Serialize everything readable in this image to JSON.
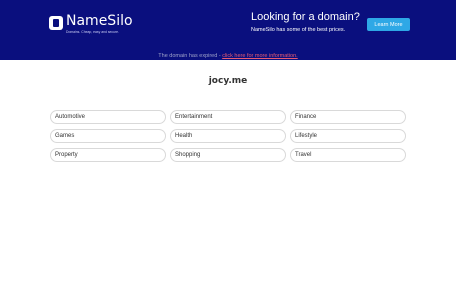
{
  "brand": {
    "name": "NameSilo",
    "tagline": "Domains. Cheap, easy and secure.",
    "logo_icon": "namesilo-logo-icon"
  },
  "promo": {
    "title": "Looking for a domain?",
    "subtitle": "NameSilo has some of the best prices.",
    "button_label": "Learn More"
  },
  "notice": {
    "text": "The domain has expired - ",
    "link": "click here for more information."
  },
  "domain": "jocy.me",
  "categories": [
    "Automotive",
    "Entertainment",
    "Finance",
    "Games",
    "Health",
    "Lifestyle",
    "Property",
    "Shopping",
    "Travel"
  ],
  "colors": {
    "banner": "#0a0f7e",
    "button": "#2ea8e6",
    "link": "#e85b72"
  }
}
